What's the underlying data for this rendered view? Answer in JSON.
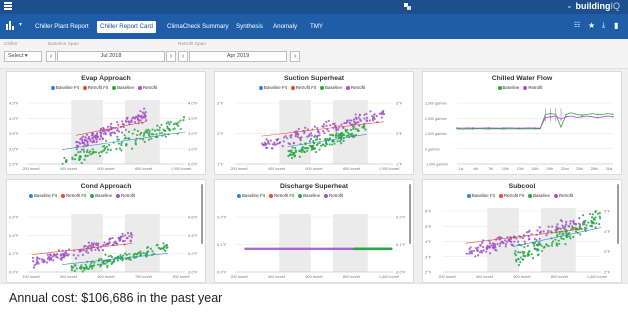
{
  "header": {
    "logo_main": "building",
    "logo_suffix": "IQ"
  },
  "nav": {
    "tabs": [
      "Chiller Plant Report",
      "Chiller Report Card",
      "ClimaCheck Summary",
      "Synthesis",
      "Anomaly",
      "TMY"
    ],
    "active_tab": "Chiller Report Card"
  },
  "filters": {
    "chiller_label": "Chiller",
    "chiller_value": "Select",
    "baseline_label": "Baseline Span",
    "baseline_value": "Jul 2018",
    "retrofit_label": "Retrofit Span",
    "retrofit_value": "Apr 2019"
  },
  "colors": {
    "baseline_fit": "#2f86d6",
    "retrofit_fit": "#e6483b",
    "baseline": "#27a844",
    "retrofit": "#a151c7"
  },
  "chart_data": [
    {
      "type": "scatter",
      "title": "Evap Approach",
      "legend": [
        "Baseline Fit",
        "Retrofit Fit",
        "Baseline",
        "Retrofit"
      ],
      "x_ticks": [
        "200 tonref",
        "400 tonref",
        "600 tonref",
        "800 tonref",
        "1,000 tonref"
      ],
      "y_ticks_left": [
        "4.5°F",
        "4.0°F",
        "3.5°F",
        "3.0°F",
        "2.5°F"
      ],
      "y_ticks_right": [
        "4.0°F",
        "3.0°F",
        "2.0°F",
        "1.0°F",
        "0.0°F"
      ],
      "xlim": [
        100,
        1000
      ],
      "ylim": [
        2.5,
        4.8
      ],
      "series": [
        {
          "name": "Retrofit",
          "cluster": {
            "x": [
              380,
              780
            ],
            "y": [
              3.2,
              4.3
            ]
          }
        },
        {
          "name": "Baseline",
          "cluster": {
            "x": [
              300,
              1000
            ],
            "y": [
              2.6,
              4.0
            ]
          }
        }
      ]
    },
    {
      "type": "scatter",
      "title": "Suction Superheat",
      "legend": [
        "Baseline Fit",
        "Retrofit Fit",
        "Baseline",
        "Retrofit"
      ],
      "x_ticks": [
        "200 tonref",
        "400 tonref",
        "600 tonref",
        "800 tonref",
        "1,000 tonref"
      ],
      "y_ticks_left": [
        "3°F",
        "2°F",
        "1°F"
      ],
      "y_ticks_right": [
        "3°F",
        "2°F",
        "1°F"
      ],
      "xlim": [
        100,
        1000
      ],
      "ylim": [
        0.8,
        3.6
      ],
      "series": [
        {
          "name": "Retrofit",
          "cluster": {
            "x": [
              250,
              950
            ],
            "y": [
              1.6,
              3.0
            ]
          }
        },
        {
          "name": "Baseline",
          "cluster": {
            "x": [
              400,
              850
            ],
            "y": [
              1.2,
              2.4
            ]
          }
        }
      ]
    },
    {
      "type": "line",
      "title": "Chilled Water Flow",
      "legend": [
        "Baseline",
        "Retrofit"
      ],
      "x_ticks": [
        "1st",
        "4th",
        "7th",
        "10th",
        "13th",
        "16th",
        "19th",
        "22nd",
        "25th",
        "28th",
        "31st"
      ],
      "y_ticks": [
        "3,000 gal/min",
        "2,000 gal/min",
        "1,000 gal/min",
        "0 gal/min",
        "-1,000 gal/min"
      ],
      "xlim": [
        1,
        31
      ],
      "ylim": [
        -1000,
        3000
      ],
      "series": [
        {
          "name": "Baseline",
          "values": [
            1200,
            1180,
            1200,
            1190,
            1210,
            1200,
            1190,
            1200,
            1200,
            1190,
            1200,
            1195,
            1200,
            1200,
            1200,
            1200,
            1200,
            2100,
            2150,
            2100,
            1300,
            2100,
            2200,
            2100,
            2050,
            2100,
            2150,
            2100,
            2100,
            2150,
            2100
          ]
        },
        {
          "name": "Retrofit",
          "values": [
            1250,
            1240,
            1260,
            1250,
            1240,
            1250,
            1260,
            1250,
            1240,
            1250,
            1260,
            1250,
            1240,
            1250,
            1260,
            1250,
            1240,
            1900,
            1950,
            2000,
            1800,
            1950,
            2000,
            1900,
            1950,
            2000,
            1950,
            1900,
            1950,
            2000,
            1950
          ]
        }
      ]
    },
    {
      "type": "scatter",
      "title": "Cond Approach",
      "legend": [
        "Baseline Fit",
        "Retrofit Fit",
        "Baseline",
        "Retrofit"
      ],
      "x_ticks": [
        "100 tonref",
        "300 tonref",
        "500 tonref",
        "700 tonref",
        "900 tonref"
      ],
      "y_ticks_left": [
        "0.6°F",
        "0.4°F",
        "0.2°F",
        "0.0°F"
      ],
      "y_ticks_right": [
        "0.6°F",
        "0.4°F",
        "0.2°F",
        "0.0°F"
      ],
      "xlim": [
        100,
        1000
      ],
      "ylim": [
        0,
        0.7
      ],
      "series": [
        {
          "name": "Retrofit",
          "cluster": {
            "x": [
              130,
              700
            ],
            "y": [
              0.12,
              0.42
            ]
          }
        },
        {
          "name": "Baseline",
          "cluster": {
            "x": [
              300,
              900
            ],
            "y": [
              0.0,
              0.3
            ]
          }
        }
      ]
    },
    {
      "type": "scatter",
      "title": "Discharge Superheat",
      "legend": [
        "Baseline Fit",
        "Retrofit Fit",
        "Baseline",
        "Retrofit"
      ],
      "x_ticks": [
        "200 tonref",
        "400 tonref",
        "600 tonref",
        "800 tonref",
        "1,000 tonref"
      ],
      "y_ticks_left": [
        "0.2°F",
        "0.1°F",
        "0.0°F"
      ],
      "y_ticks_right": [
        "0.2°F",
        "0.1°F",
        "0.0°F"
      ],
      "xlim": [
        100,
        1000
      ],
      "ylim": [
        0,
        0.25
      ],
      "series": [
        {
          "name": "Retrofit",
          "cluster": {
            "x": [
              160,
              820
            ],
            "y": [
              0.1,
              0.1
            ]
          }
        },
        {
          "name": "Baseline",
          "cluster": {
            "x": [
              780,
              990
            ],
            "y": [
              0.1,
              0.1
            ]
          }
        }
      ]
    },
    {
      "type": "scatter",
      "title": "Subcool",
      "legend": [
        "Baseline Fit",
        "Retrofit Fit",
        "Baseline",
        "Retrofit"
      ],
      "x_ticks": [
        "200 tonref",
        "400 tonref",
        "600 tonref",
        "800 tonref",
        "1,000 tonref"
      ],
      "y_ticks_left": [
        "6°F",
        "5°F",
        "4°F",
        "3°F",
        "2°F"
      ],
      "y_ticks_right": [
        "5°F",
        "4°F",
        "3°F",
        "2°F"
      ],
      "xlim": [
        100,
        1000
      ],
      "ylim": [
        1.5,
        6.5
      ],
      "series": [
        {
          "name": "Retrofit",
          "cluster": {
            "x": [
              230,
              900
            ],
            "y": [
              3.0,
              5.5
            ]
          }
        },
        {
          "name": "Baseline",
          "cluster": {
            "x": [
              500,
              1000
            ],
            "y": [
              2.5,
              5.8
            ]
          }
        }
      ]
    }
  ],
  "footer": {
    "annual_cost": "Annual cost: $106,686 in the past year"
  }
}
